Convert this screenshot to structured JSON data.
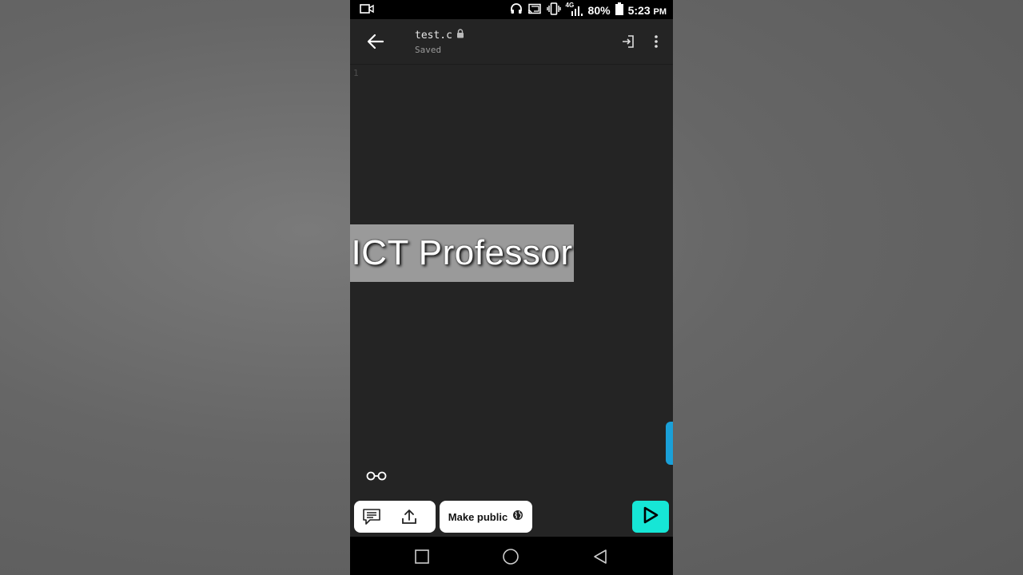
{
  "status_bar": {
    "battery": "80%",
    "time": "5:23",
    "ampm": "PM",
    "network": "4G",
    "icons": [
      "video-record-icon",
      "headphones-icon",
      "cast-icon",
      "vibrate-icon",
      "signal-icon",
      "battery-icon"
    ]
  },
  "app_bar": {
    "filename": "test.c",
    "save_status": "Saved",
    "icons": [
      "back-arrow-icon",
      "lock-icon",
      "enter-icon",
      "more-vert-icon"
    ]
  },
  "editor": {
    "line_numbers": [
      "1"
    ]
  },
  "watermark": {
    "text": "ICT Professor"
  },
  "bottom_bar": {
    "make_public_label": "Make public",
    "icons": [
      "glasses-icon",
      "comment-icon",
      "upload-icon",
      "globe-icon",
      "play-icon"
    ]
  },
  "nav_bar": {
    "icons": [
      "recents-square-icon",
      "home-circle-icon",
      "back-triangle-icon"
    ]
  },
  "colors": {
    "editor_bg": "#242424",
    "run_button": "#16e6d6",
    "scroll_handle": "#1aa0d8"
  }
}
